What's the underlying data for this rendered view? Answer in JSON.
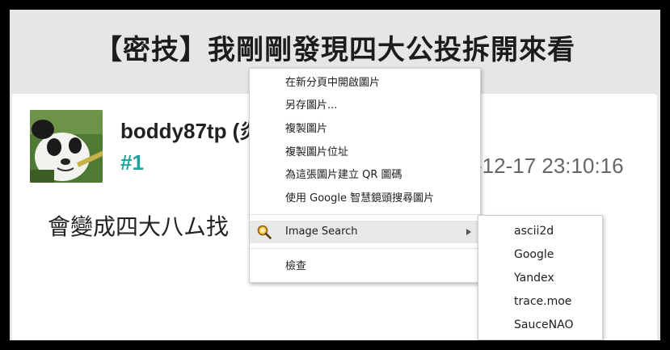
{
  "post": {
    "title": "【密技】我剛剛發現四大公投拆開來看",
    "username": "boddy87tp (炎",
    "floor": "#1",
    "timestamp": "-12-17 23:10:16",
    "body": "會變成四大八ム找"
  },
  "avatar": {
    "icon": "panda-avatar"
  },
  "context_menu": {
    "items": [
      {
        "label": "在新分頁中開啟圖片"
      },
      {
        "label": "另存圖片..."
      },
      {
        "label": "複製圖片"
      },
      {
        "label": "複製圖片位址"
      },
      {
        "label": "為這張圖片建立 QR 圖碼"
      },
      {
        "label": "使用 Google 智慧鏡頭搜尋圖片"
      }
    ],
    "extension_item": {
      "label": "Image Search",
      "icon": "magnifier-icon"
    },
    "inspect_item": {
      "label": "檢查"
    }
  },
  "image_search_submenu": {
    "items": [
      {
        "label": "ascii2d"
      },
      {
        "label": "Google"
      },
      {
        "label": "Yandex"
      },
      {
        "label": "trace.moe"
      },
      {
        "label": "SauceNAO"
      }
    ]
  },
  "colors": {
    "floor_accent": "#1aa3a0",
    "page_background": "#e6e6e6",
    "menu_hover": "#e8e8e8"
  }
}
